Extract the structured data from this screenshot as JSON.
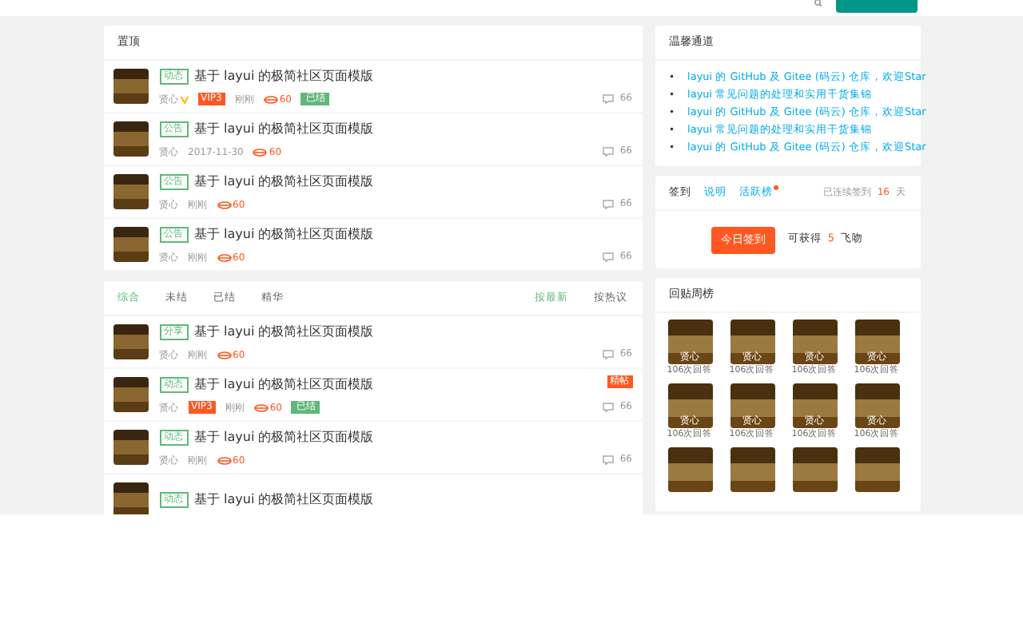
{
  "top_posts": {
    "title": "置顶",
    "rows": [
      {
        "tag": "动态",
        "title": "基于 layui 的极简社区页面模版",
        "author": "贤心",
        "verified": true,
        "vip": "VIP3",
        "time": "刚刚",
        "views": "60",
        "status": "已结",
        "comments": "66",
        "pinned": null
      },
      {
        "tag": "公告",
        "title": "基于 layui 的极简社区页面模版",
        "author": "贤心",
        "verified": false,
        "vip": null,
        "time": "2017-11-30",
        "views": "60",
        "status": null,
        "comments": "66",
        "pinned": null
      },
      {
        "tag": "公告",
        "title": "基于 layui 的极简社区页面模版",
        "author": "贤心",
        "verified": false,
        "vip": null,
        "time": "刚刚",
        "views": "60",
        "status": null,
        "comments": "66",
        "pinned": null
      },
      {
        "tag": "公告",
        "title": "基于 layui 的极简社区页面模版",
        "author": "贤心",
        "verified": false,
        "vip": null,
        "time": "刚刚",
        "views": "60",
        "status": null,
        "comments": "66",
        "pinned": null
      }
    ]
  },
  "post_list": {
    "filters": [
      {
        "label": "综合",
        "selected": true
      },
      {
        "label": "未结",
        "selected": false
      },
      {
        "label": "已结",
        "selected": false
      },
      {
        "label": "精华",
        "selected": false
      }
    ],
    "sorts": [
      {
        "label": "按最新",
        "selected": true
      },
      {
        "label": "按热议",
        "selected": false
      }
    ],
    "rows": [
      {
        "tag": "分享",
        "title": "基于 layui 的极简社区页面模版",
        "author": "贤心",
        "verified": false,
        "vip": null,
        "time": "刚刚",
        "views": "60",
        "status": null,
        "comments": "66",
        "pinned": null
      },
      {
        "tag": "动态",
        "title": "基于 layui 的极简社区页面模版",
        "author": "贤心",
        "verified": false,
        "vip": "VIP3",
        "time": "刚刚",
        "views": "60",
        "status": "已结",
        "comments": "66",
        "pinned": "精帖"
      },
      {
        "tag": "动态",
        "title": "基于 layui 的极简社区页面模版",
        "author": "贤心",
        "verified": false,
        "vip": null,
        "time": "刚刚",
        "views": "60",
        "status": null,
        "comments": "66",
        "pinned": null
      },
      {
        "tag": "动态",
        "title": "基于 layui 的极简社区页面模版"
      }
    ]
  },
  "channel": {
    "title": "温馨通道",
    "links": [
      {
        "marker": "•",
        "text": "layui 的 GitHub 及 Gitee (码云) 仓库，欢迎Star"
      },
      {
        "marker": "•",
        "text": "layui 常见问题的处理和实用干货集锦"
      },
      {
        "marker": "•",
        "text": "layui 的 GitHub 及 Gitee (码云) 仓库，欢迎Star"
      },
      {
        "marker": "•",
        "text": "layui 常见问题的处理和实用干货集锦"
      },
      {
        "marker": "•",
        "text": "layui 的 GitHub 及 Gitee (码云) 仓库，欢迎Star"
      }
    ]
  },
  "signin": {
    "tabs": [
      {
        "label": "签到",
        "selected": true,
        "dot": false
      },
      {
        "label": "说明",
        "selected": false,
        "dot": false
      },
      {
        "label": "活跃榜",
        "selected": false,
        "dot": true
      }
    ],
    "streak_prefix": "已连续签到",
    "streak_days": "16",
    "streak_suffix": "天",
    "button": "今日签到",
    "reward_prefix": "可获得",
    "reward_amount": "5",
    "reward_suffix": "飞吻"
  },
  "weekly": {
    "title": "回贴周榜",
    "users": [
      {
        "kind": "user",
        "name": "贤心",
        "answers": "106次回答"
      },
      {
        "kind": "user",
        "name": "贤心",
        "answers": "106次回答"
      },
      {
        "kind": "user",
        "name": "贤心",
        "answers": "106次回答"
      },
      {
        "kind": "user",
        "name": "贤心",
        "answers": "106次回答"
      },
      {
        "kind": "user",
        "name": "贤心",
        "answers": "106次回答"
      },
      {
        "kind": "user",
        "name": "贤心",
        "answers": "106次回答"
      },
      {
        "kind": "user",
        "name": "贤心",
        "answers": "106次回答"
      },
      {
        "kind": "user",
        "name": "贤心",
        "answers": "106次回答"
      },
      {
        "kind": "avatar_only"
      },
      {
        "kind": "avatar_only"
      },
      {
        "kind": "avatar_only"
      },
      {
        "kind": "avatar_only"
      }
    ]
  }
}
